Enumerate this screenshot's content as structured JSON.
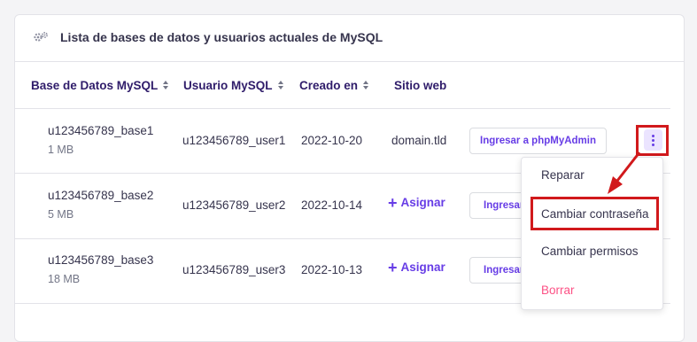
{
  "card": {
    "title": "Lista de bases de datos y usuarios actuales de MySQL",
    "icon": "gears-icon"
  },
  "table": {
    "headers": [
      {
        "label": "Base de Datos MySQL",
        "sortable": true
      },
      {
        "label": "Usuario MySQL",
        "sortable": true
      },
      {
        "label": "Creado en",
        "sortable": true
      },
      {
        "label": "Sitio web",
        "sortable": false
      }
    ],
    "rows": [
      {
        "db": "u123456789_base1",
        "size": "1 MB",
        "user": "u123456789_user1",
        "created": "2022-10-20",
        "site": "domain.tld",
        "action": "Ingresar a phpMyAdmin"
      },
      {
        "db": "u123456789_base2",
        "size": "5 MB",
        "user": "u123456789_user2",
        "created": "2022-10-14",
        "site": "Asignar",
        "action": "Ingresar"
      },
      {
        "db": "u123456789_base3",
        "size": "18 MB",
        "user": "u123456789_user3",
        "created": "2022-10-13",
        "site": "Asignar",
        "action": "Ingresar"
      }
    ]
  },
  "menu": {
    "items": [
      "Reparar",
      "Cambiar contraseña",
      "Cambiar permisos",
      "Borrar"
    ]
  },
  "colors": {
    "accent": "#673de6",
    "highlight": "#d1191c",
    "danger": "#fc5185"
  }
}
